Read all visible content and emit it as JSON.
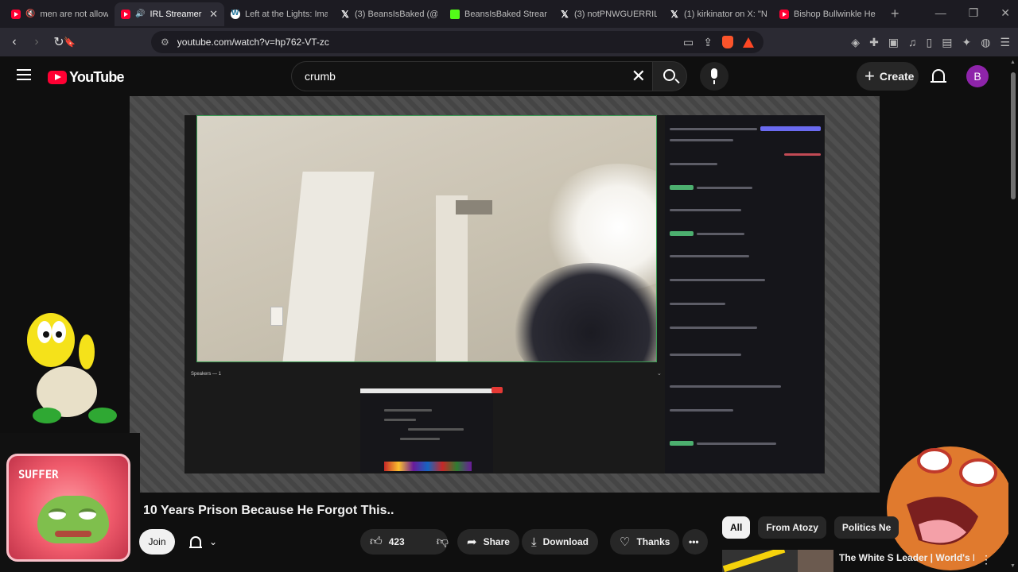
{
  "browser": {
    "tabs": [
      {
        "title": "men are not allow",
        "icon": "youtube-icon",
        "muted": true
      },
      {
        "title": "IRL Streamer F",
        "icon": "youtube-icon",
        "active": true
      },
      {
        "title": "Left at the Lights: Ima",
        "icon": "wordpress-icon"
      },
      {
        "title": "(3) BeansIsBaked (@B",
        "icon": "x-icon"
      },
      {
        "title": "BeansIsBaked Stream",
        "icon": "kick-icon"
      },
      {
        "title": "(3) notPNWGUERRILL",
        "icon": "x-icon"
      },
      {
        "title": "(1) kirkinator on X: \"N",
        "icon": "x-icon"
      },
      {
        "title": "Bishop Bullwinkle He",
        "icon": "youtube-icon"
      }
    ],
    "url": "youtube.com/watch?v=hp762-VT-zc"
  },
  "masthead": {
    "logo_text": "YouTube",
    "search_value": "crumb",
    "create_label": "Create",
    "avatar_letter": "B"
  },
  "player": {
    "speakers_label": "Speakers — 1"
  },
  "overlays": {
    "suffer_label": "SUFFER"
  },
  "video": {
    "title": "10 Years Prison Because He Forgot This..",
    "join_label": "Join",
    "like_count": "423",
    "share_label": "Share",
    "download_label": "Download",
    "thanks_label": "Thanks"
  },
  "sidebar": {
    "chips": [
      "All",
      "From Atozy",
      "Politics Ne"
    ],
    "recommendation_title": "The White S Leader | World's Most Evil"
  },
  "colors": {
    "youtube_red": "#ff0033",
    "background": "#0f0f0f",
    "avatar": "#8e24aa",
    "chat_green": "#3a9c53"
  }
}
